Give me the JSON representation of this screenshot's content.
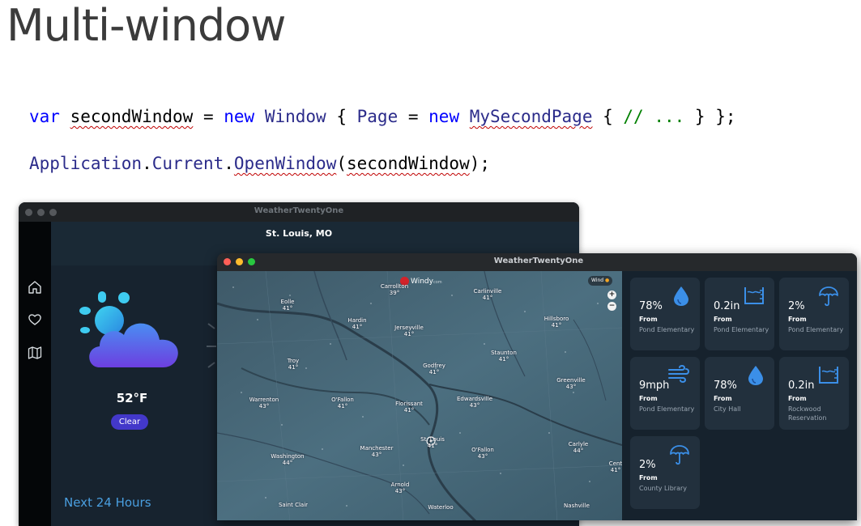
{
  "slide": {
    "title": "Multi-window",
    "code_line1": {
      "kw_var": "var",
      "second_window": "secondWindow",
      "eq": " = ",
      "kw_new1": "new",
      "type_window": "Window",
      "brace_open": " { ",
      "prop_page": "Page",
      "eq2": " = ",
      "kw_new2": "new",
      "type_page": "MySecondPage",
      "brace_open2": " { ",
      "comment": "// ...",
      "brace_close": " } };"
    },
    "code_line2": {
      "app": "Application",
      "dot1": ".",
      "current": "Current",
      "dot2": ".",
      "open_window": "OpenWindow",
      "paren_open": "(",
      "arg": "secondWindow",
      "paren_close": ");"
    }
  },
  "window_main": {
    "title": "WeatherTwentyOne",
    "city": "St. Louis, MO",
    "temperature": "52°F",
    "condition_button": "Clear",
    "next_label": "Next 24 Hours",
    "nav_icons": [
      "home-icon",
      "favorites-heart-icon",
      "map-icon"
    ]
  },
  "window_second": {
    "title": "WeatherTwentyOne",
    "map": {
      "brand": "Windy",
      "brand_suffix": "com",
      "layer_chip": "Wind",
      "zoom_in": "+",
      "zoom_out": "−",
      "cities": [
        {
          "name": "Carrollton",
          "temp": "39°"
        },
        {
          "name": "Carlinville",
          "temp": "41°"
        },
        {
          "name": "Eolle",
          "temp": "41°"
        },
        {
          "name": "Hardin",
          "temp": "41°"
        },
        {
          "name": "Jerseyville",
          "temp": "41°"
        },
        {
          "name": "Hillsboro",
          "temp": "41°"
        },
        {
          "name": "Troy",
          "temp": "41°"
        },
        {
          "name": "Godfrey",
          "temp": "41°"
        },
        {
          "name": "Staunton",
          "temp": "41°"
        },
        {
          "name": "Greenville",
          "temp": "43°"
        },
        {
          "name": "Warrenton",
          "temp": "43°"
        },
        {
          "name": "O'Fallon",
          "temp": "41°"
        },
        {
          "name": "Florissant",
          "temp": "41°"
        },
        {
          "name": "Edwardsville",
          "temp": "43°"
        },
        {
          "name": "St. Louis",
          "temp": "41°"
        },
        {
          "name": "Washington",
          "temp": "44°"
        },
        {
          "name": "Manchester",
          "temp": "43°"
        },
        {
          "name": "O'Fallon",
          "temp": "43°"
        },
        {
          "name": "Carlyle",
          "temp": "44°"
        },
        {
          "name": "Arnold",
          "temp": "43°"
        },
        {
          "name": "Cent",
          "temp": "41°"
        },
        {
          "name": "Saint Clair",
          "temp": ""
        },
        {
          "name": "Waterloo",
          "temp": ""
        },
        {
          "name": "Nashville",
          "temp": ""
        }
      ]
    },
    "tiles": [
      {
        "value": "78%",
        "from": "From",
        "location": "Pond Elementary",
        "icon": "humidity-drop-icon"
      },
      {
        "value": "0.2in",
        "from": "From",
        "location": "Pond Elementary",
        "icon": "rain-gauge-icon"
      },
      {
        "value": "2%",
        "from": "From",
        "location": "Pond Elementary",
        "icon": "umbrella-icon"
      },
      {
        "value": "9mph",
        "from": "From",
        "location": "Pond Elementary",
        "icon": "wind-icon"
      },
      {
        "value": "78%",
        "from": "From",
        "location": "City Hall",
        "icon": "humidity-drop-icon"
      },
      {
        "value": "0.2in",
        "from": "From",
        "location": "Rockwood Reservation",
        "icon": "rain-gauge-icon"
      },
      {
        "value": "2%",
        "from": "From",
        "location": "County Library",
        "icon": "umbrella-icon"
      }
    ]
  },
  "colors": {
    "accent_button": "#4338ca",
    "next_label": "#4a9fe0",
    "icon_blue": "#3b8fe8",
    "traffic_red": "#ff5f57",
    "traffic_yellow": "#febc2e",
    "traffic_green": "#28c840"
  }
}
